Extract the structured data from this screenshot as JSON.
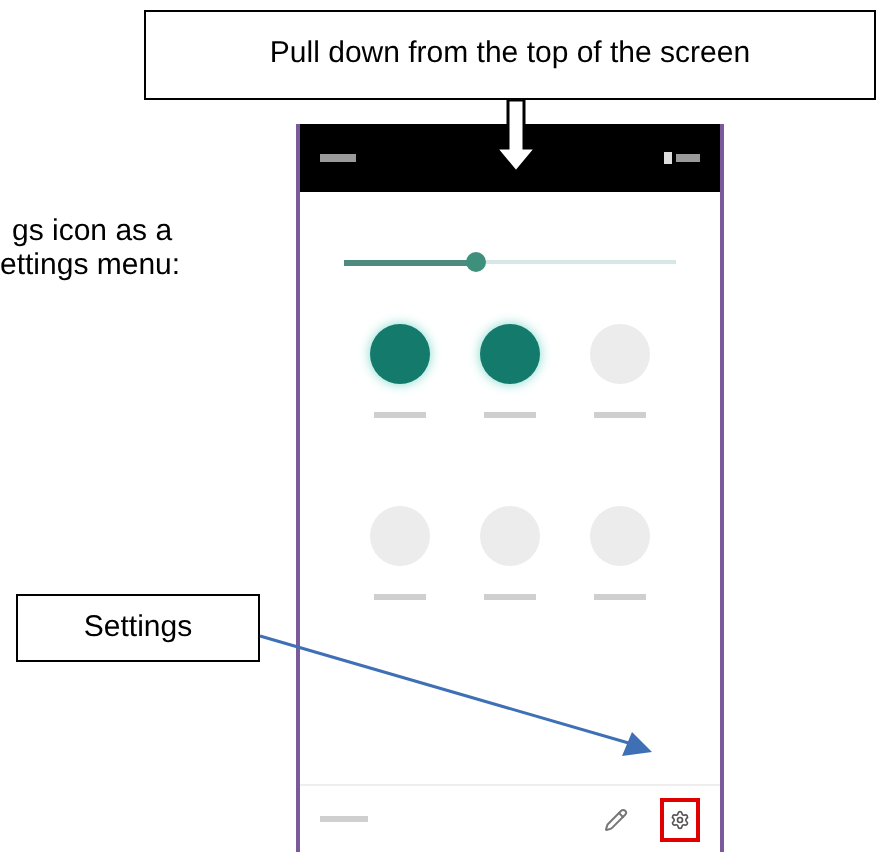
{
  "top_callout": {
    "text": "Pull down from the top of the screen"
  },
  "side_text": [
    "gs icon as a",
    "ettings menu:"
  ],
  "brightness": {
    "level": 0.4
  },
  "tiles": [
    {
      "on": true
    },
    {
      "on": true
    },
    {
      "on": false
    },
    {
      "on": false
    },
    {
      "on": false
    },
    {
      "on": false
    }
  ],
  "settings_callout": {
    "text": "Settings"
  }
}
